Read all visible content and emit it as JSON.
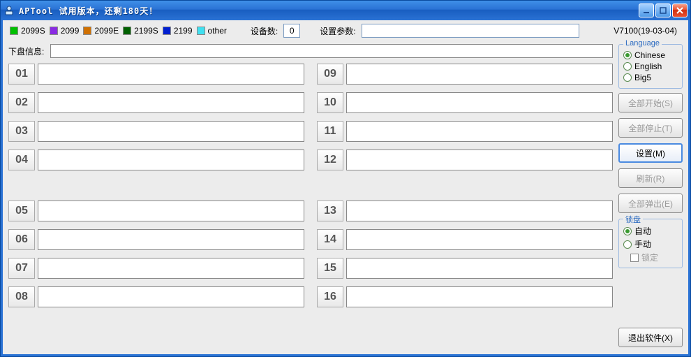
{
  "title": "APTool   试用版本，还剩180天！",
  "legend": [
    {
      "label": "2099S",
      "color": "#00c000"
    },
    {
      "label": "2099",
      "color": "#8a2be2"
    },
    {
      "label": "2099E",
      "color": "#d07000"
    },
    {
      "label": "2199S",
      "color": "#006000"
    },
    {
      "label": "2199",
      "color": "#0020d0"
    },
    {
      "label": "other",
      "color": "#40e0f0"
    }
  ],
  "device_count_label": "设备数:",
  "device_count": "0",
  "param_label": "设置参数:",
  "param_value": "",
  "version": "V7100(19-03-04)",
  "disk_info_label": "下盘信息:",
  "disk_info_value": "",
  "slots": [
    "01",
    "02",
    "03",
    "04",
    "05",
    "06",
    "07",
    "08",
    "09",
    "10",
    "11",
    "12",
    "13",
    "14",
    "15",
    "16"
  ],
  "language": {
    "title": "Language",
    "options": [
      {
        "label": "Chinese",
        "checked": true
      },
      {
        "label": "English",
        "checked": false
      },
      {
        "label": "Big5",
        "checked": false
      }
    ]
  },
  "buttons": {
    "start_all": "全部开始(S)",
    "stop_all": "全部停止(T)",
    "settings": "设置(M)",
    "refresh": "刷新(R)",
    "eject_all": "全部弹出(E)",
    "exit": "退出软件(X)"
  },
  "lock": {
    "title": "锁盘",
    "auto": "自动",
    "manual": "手动",
    "lock": "锁定"
  }
}
